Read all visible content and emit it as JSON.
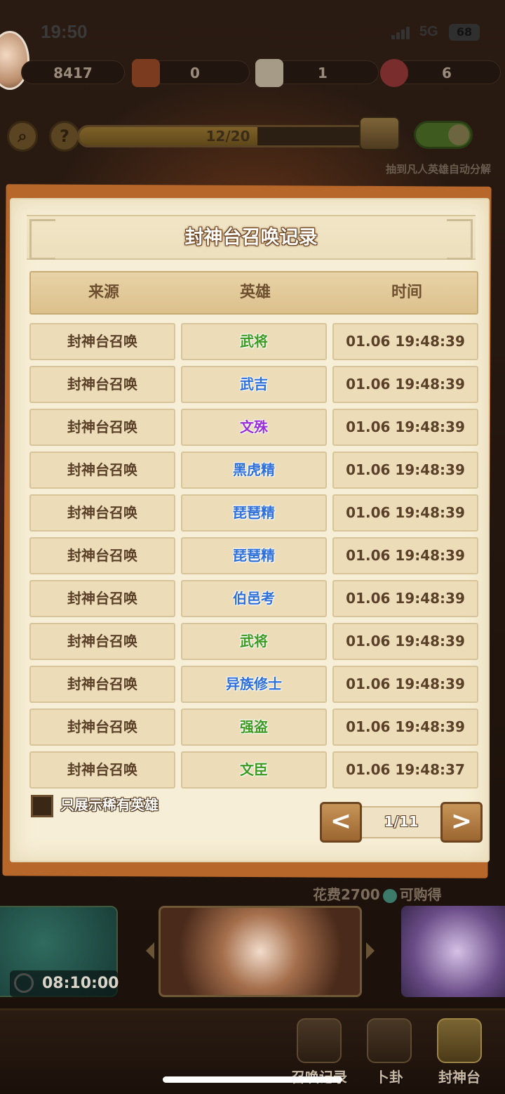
{
  "status_bar": {
    "time": "19:50",
    "network": "5G",
    "battery": "68"
  },
  "resources": [
    {
      "name": "jade",
      "value": "8417"
    },
    {
      "name": "bag",
      "value": "0"
    },
    {
      "name": "scroll",
      "value": "1"
    },
    {
      "name": "heart",
      "value": "6"
    }
  ],
  "controls": {
    "progress_text": "12/20",
    "progress_fraction": 0.6,
    "auto_decompose_label": "抽到凡人英雄自动分解",
    "auto_decompose_on": true
  },
  "dialog": {
    "title": "封神台召唤记录",
    "columns": [
      "来源",
      "英雄",
      "时间"
    ],
    "records": [
      {
        "source": "封神台召唤",
        "hero": "武将",
        "hero_color": "#3c9a1e",
        "time": "01.06 19:48:39"
      },
      {
        "source": "封神台召唤",
        "hero": "武吉",
        "hero_color": "#2f6fd8",
        "time": "01.06 19:48:39"
      },
      {
        "source": "封神台召唤",
        "hero": "文殊",
        "hero_color": "#9a2fd8",
        "time": "01.06 19:48:39"
      },
      {
        "source": "封神台召唤",
        "hero": "黑虎精",
        "hero_color": "#2f6fd8",
        "time": "01.06 19:48:39"
      },
      {
        "source": "封神台召唤",
        "hero": "琵琶精",
        "hero_color": "#2f6fd8",
        "time": "01.06 19:48:39"
      },
      {
        "source": "封神台召唤",
        "hero": "琵琶精",
        "hero_color": "#2f6fd8",
        "time": "01.06 19:48:39"
      },
      {
        "source": "封神台召唤",
        "hero": "伯邑考",
        "hero_color": "#2f6fd8",
        "time": "01.06 19:48:39"
      },
      {
        "source": "封神台召唤",
        "hero": "武将",
        "hero_color": "#3c9a1e",
        "time": "01.06 19:48:39"
      },
      {
        "source": "封神台召唤",
        "hero": "异族修士",
        "hero_color": "#2f6fd8",
        "time": "01.06 19:48:39"
      },
      {
        "source": "封神台召唤",
        "hero": "强盗",
        "hero_color": "#3c9a1e",
        "time": "01.06 19:48:39"
      },
      {
        "source": "封神台召唤",
        "hero": "文臣",
        "hero_color": "#3c9a1e",
        "time": "01.06 19:48:37"
      }
    ],
    "filter_label": "只展示稀有英雄",
    "filter_checked": false,
    "pager": {
      "text": "1/11",
      "prev": "<",
      "next": ">"
    }
  },
  "bottom": {
    "cost_prefix": "花费2700",
    "cost_suffix": "可购得",
    "timer": "08:10:00",
    "nav": [
      "召唤记录",
      "卜卦",
      "封神台"
    ]
  }
}
